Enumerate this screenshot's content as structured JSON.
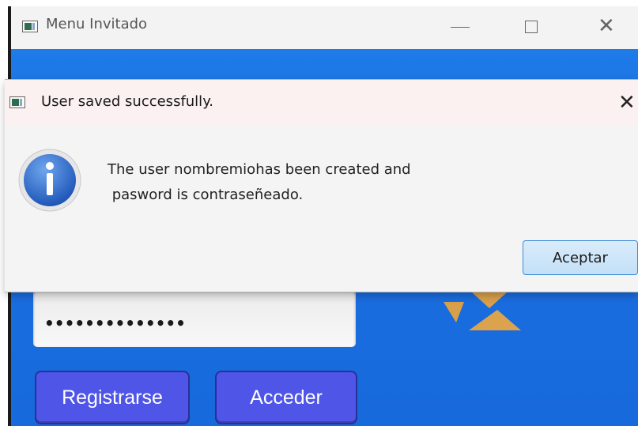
{
  "main_window": {
    "title": "Menu Invitado",
    "password_mask": "••••••••••••••",
    "register_label": "Registrarse",
    "login_label": "Acceder",
    "accent_color": "#1e7ae8",
    "button_color": "#4f55e6"
  },
  "dialog": {
    "title": "User saved successfully.",
    "close_glyph": "✕",
    "message_line1": "The user nombremiohas been created and",
    "message_line2": " pasword is contraseñeado.",
    "accept_label": "Aceptar",
    "icon": "info-icon"
  },
  "window_controls": {
    "minimize": "minimize-icon",
    "maximize": "maximize-icon",
    "close_glyph": "✕"
  }
}
